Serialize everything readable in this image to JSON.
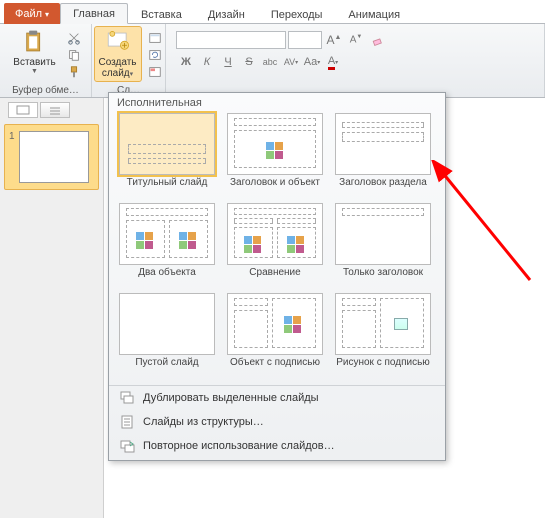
{
  "tabs": {
    "file": "Файл",
    "home": "Главная",
    "insert": "Вставка",
    "design": "Дизайн",
    "transitions": "Переходы",
    "animation": "Анимация"
  },
  "groups": {
    "clipboard_button": "Вставить",
    "clipboard_label": "Буфер обме…",
    "newslide_button_line1": "Создать",
    "newslide_button_line2": "слайд",
    "slides_label": "Сл…"
  },
  "font_buttons": {
    "bold": "Ж",
    "italic": "К",
    "underline": "Ч",
    "strike": "S",
    "shadow": "abc",
    "spacing": "AV",
    "case": "Aa",
    "fontcolor": "A"
  },
  "slide_panel": {
    "num": "1"
  },
  "gallery": {
    "title": "Исполнительная",
    "items": [
      {
        "label": "Титульный слайд"
      },
      {
        "label": "Заголовок и объект"
      },
      {
        "label": "Заголовок раздела"
      },
      {
        "label": "Два объекта"
      },
      {
        "label": "Сравнение"
      },
      {
        "label": "Только заголовок"
      },
      {
        "label": "Пустой слайд"
      },
      {
        "label": "Объект с подписью"
      },
      {
        "label": "Рисунок с подписью"
      }
    ],
    "menu": {
      "duplicate": "Дублировать выделенные слайды",
      "from_outline": "Слайды из структуры…",
      "reuse": "Повторное использование слайдов…"
    }
  }
}
